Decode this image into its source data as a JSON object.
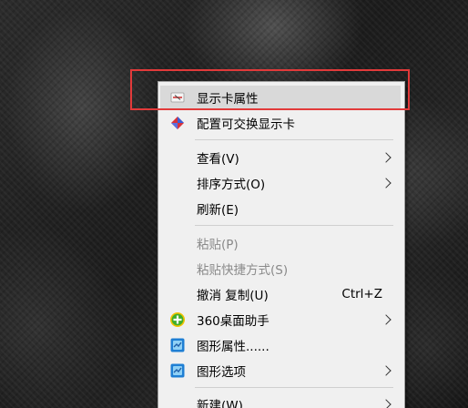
{
  "context_menu": {
    "items": [
      {
        "label": "显示卡属性",
        "icon": "display-card-properties-icon",
        "enabled": true,
        "highlighted": true
      },
      {
        "label": "配置可交换显示卡",
        "icon": "switchable-graphics-icon",
        "enabled": true
      },
      {
        "label": "查看(V)",
        "submenu": true,
        "enabled": true
      },
      {
        "label": "排序方式(O)",
        "submenu": true,
        "enabled": true
      },
      {
        "label": "刷新(E)",
        "enabled": true
      },
      {
        "label": "粘贴(P)",
        "enabled": false
      },
      {
        "label": "粘贴快捷方式(S)",
        "enabled": false
      },
      {
        "label": "撤消 复制(U)",
        "shortcut": "Ctrl+Z",
        "enabled": true
      },
      {
        "label": "360桌面助手",
        "icon": "360-desktop-assistant-icon",
        "submenu": true,
        "enabled": true
      },
      {
        "label": "图形属性......",
        "icon": "graphics-properties-icon",
        "enabled": true
      },
      {
        "label": "图形选项",
        "icon": "graphics-options-icon",
        "submenu": true,
        "enabled": true
      },
      {
        "label": "新建(W)",
        "submenu": true,
        "enabled": true
      }
    ]
  },
  "colors": {
    "menu_background": "#f0f0f0",
    "highlight": "#d9d9d9",
    "disabled_text": "#8a8a8a",
    "annotation_box": "#e23a3a"
  }
}
